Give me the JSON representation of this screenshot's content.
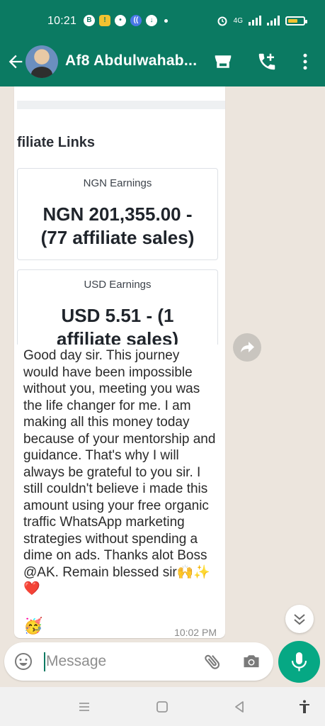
{
  "status_bar": {
    "time": "10:21",
    "network_label": "4G",
    "battery_level": 0.55
  },
  "header": {
    "contact_name": "Af8 Abdulwahab...",
    "back_icon": "arrow-left-icon",
    "actions": [
      "store-icon",
      "add-call-icon",
      "more-vert-icon"
    ]
  },
  "shared_image": {
    "section_title": "filiate Links",
    "cards": [
      {
        "title": "NGN Earnings",
        "value_line1": "NGN 201,355.00 -",
        "value_line2": "(77 affiliate sales)"
      },
      {
        "title": "USD Earnings",
        "value_line1": "USD 5.51 - (1",
        "value_line2": "affiliate sales)"
      }
    ]
  },
  "message": {
    "text": "Good day sir. This journey would have been impossible without you, meeting you was the life changer for me. I am making all this money today because of your mentorship and guidance. That's why I will always be grateful to you sir. I still couldn't believe i made this amount using your free organic traffic WhatsApp marketing strategies without spending a dime on ads. Thanks alot Boss @AK. Remain blessed sir🙌✨❤️",
    "trailing_emoji": "🥳",
    "time": "10:02 PM"
  },
  "composer": {
    "placeholder": "Message"
  },
  "colors": {
    "header": "#0b7a62",
    "mic_button": "#06a884",
    "chat_background": "#ece5dd"
  }
}
